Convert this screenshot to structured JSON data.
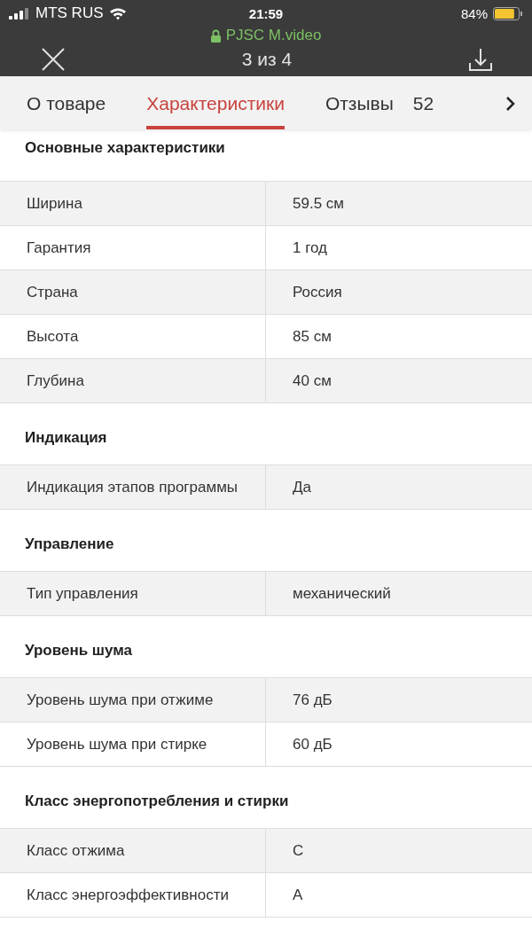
{
  "status_bar": {
    "carrier": "MTS RUS",
    "time": "21:59",
    "battery": "84%"
  },
  "browser": {
    "site": "PJSC M.video"
  },
  "viewer": {
    "counter": "3 из 4"
  },
  "tabs": [
    {
      "label": "О товаре",
      "selected": false
    },
    {
      "label": "Характеристики",
      "selected": true
    },
    {
      "label": "Отзывы",
      "count": "52",
      "selected": false
    }
  ],
  "sections": [
    {
      "title": "Основные характеристики",
      "rows": [
        {
          "name": "Ширина",
          "value": "59.5 см"
        },
        {
          "name": "Гарантия",
          "value": "1 год"
        },
        {
          "name": "Страна",
          "value": "Россия"
        },
        {
          "name": "Высота",
          "value": "85 см"
        },
        {
          "name": "Глубина",
          "value": "40 см"
        }
      ]
    },
    {
      "title": "Индикация",
      "rows": [
        {
          "name": "Индикация этапов программы",
          "value": "Да"
        }
      ]
    },
    {
      "title": "Управление",
      "rows": [
        {
          "name": "Тип управления",
          "value": "механический"
        }
      ]
    },
    {
      "title": "Уровень шума",
      "rows": [
        {
          "name": "Уровень шума при отжиме",
          "value": "76 дБ"
        },
        {
          "name": "Уровень шума при стирке",
          "value": "60 дБ"
        }
      ]
    },
    {
      "title": "Класс энергопотребления и стирки",
      "rows": [
        {
          "name": "Класс отжима",
          "value": "C"
        },
        {
          "name": "Класс энергоэффективности",
          "value": "A"
        }
      ]
    }
  ]
}
